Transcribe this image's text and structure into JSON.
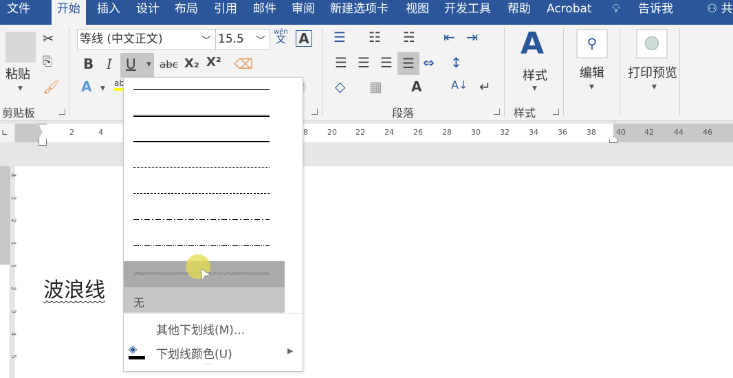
{
  "menu_tabs": [
    "文件",
    "开始",
    "插入",
    "设计",
    "布局",
    "引用",
    "邮件",
    "审阅",
    "新建选项卡",
    "视图",
    "开发工具",
    "帮助",
    "Acrobat"
  ],
  "tell_me": "告诉我",
  "share": "共",
  "clipboard": {
    "paste": "粘贴",
    "group_label": "剪贴板"
  },
  "font": {
    "name": "等线 (中文正文)",
    "size": "15.5",
    "phonetic_top": "wén",
    "phonetic_bottom": "文",
    "border_char": "A",
    "bold": "B",
    "italic": "I",
    "underline": "U",
    "strike": "abc",
    "sub": "X₂",
    "sup": "X²"
  },
  "paragraph": {
    "group_label": "段落"
  },
  "styles": {
    "label": "样式",
    "group_label": "样式"
  },
  "editing": {
    "label": "编辑"
  },
  "print_preview": {
    "label": "打印预览"
  },
  "ruler_ticks": [
    "2",
    "4",
    "8",
    "20",
    "22",
    "24",
    "26",
    "28",
    "30",
    "32",
    "34",
    "36",
    "38",
    "40",
    "42",
    "44",
    "46"
  ],
  "vruler_ticks": [
    "4",
    "3",
    "2",
    "1",
    "1",
    "2",
    "3",
    "4",
    "5"
  ],
  "document": {
    "text": "波浪线"
  },
  "underline_menu": {
    "none": "无",
    "more": "其他下划线(M)...",
    "color": "下划线颜色(U)",
    "hovered": "wave"
  },
  "colors": {
    "accent": "#2b579a",
    "hover": "#ababab",
    "selected": "#c6c6c6"
  }
}
